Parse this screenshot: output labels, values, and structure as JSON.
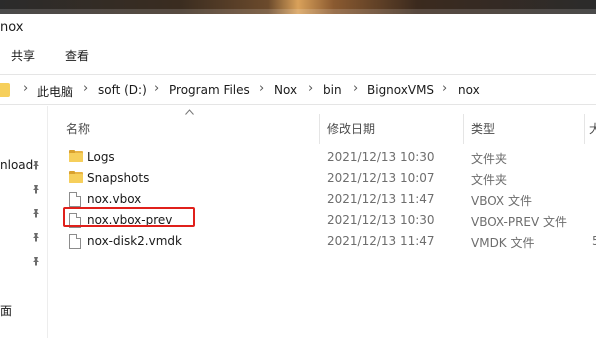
{
  "window": {
    "title": "nox"
  },
  "ribbon": {
    "tabs": [
      "共享",
      "查看"
    ]
  },
  "address": {
    "crumbs": [
      "此电脑",
      "soft (D:)",
      "Program Files",
      "Nox",
      "bin",
      "BignoxVMS",
      "nox"
    ],
    "separator": "›"
  },
  "nav": {
    "items": [
      "nload",
      "面"
    ],
    "pin_icon": "pin-icon"
  },
  "columns": {
    "name": "名称",
    "modified": "修改日期",
    "type": "类型",
    "size": "大"
  },
  "files": [
    {
      "name": "Logs",
      "date": "2021/12/13 10:30",
      "type": "文件夹",
      "size": "",
      "icon": "folder-icon"
    },
    {
      "name": "Snapshots",
      "date": "2021/12/13 10:07",
      "type": "文件夹",
      "size": "",
      "icon": "folder-icon"
    },
    {
      "name": "nox.vbox",
      "date": "2021/12/13 11:47",
      "type": "VBOX 文件",
      "size": "",
      "icon": "file-icon"
    },
    {
      "name": "nox.vbox-prev",
      "date": "2021/12/13 10:30",
      "type": "VBOX-PREV 文件",
      "size": "",
      "icon": "file-icon"
    },
    {
      "name": "nox-disk2.vmdk",
      "date": "2021/12/13 11:47",
      "type": "VMDK 文件",
      "size": "5",
      "icon": "file-icon"
    }
  ],
  "highlight": {
    "color": "#e0201b",
    "row_index": 3
  },
  "colors": {
    "folder": "#f6cf5b",
    "meta_text": "#6d6d6d"
  }
}
